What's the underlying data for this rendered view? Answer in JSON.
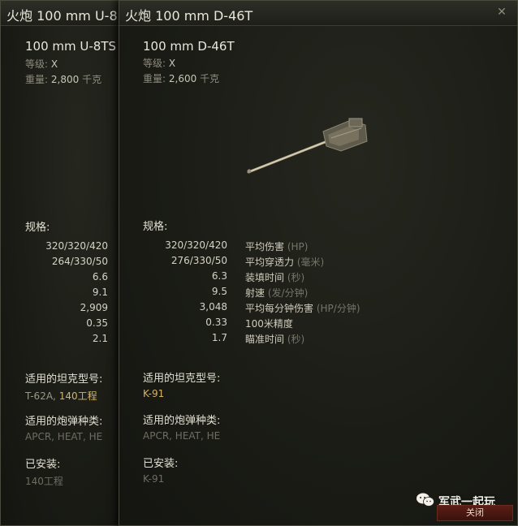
{
  "back_window": {
    "title": "火炮 100 mm U-8",
    "gun_name": "100 mm U-8TS",
    "tier_label": "等级:",
    "tier_value": "X",
    "weight_label": "重量:",
    "weight_value": "2,800",
    "weight_unit": "千克",
    "specs_heading": "规格:",
    "stats": [
      "320/320/420",
      "264/330/50",
      "6.6",
      "9.1",
      "2,909",
      "0.35",
      "2.1"
    ],
    "tanks_heading": "适用的坦克型号:",
    "tanks_plain": "T-62A,",
    "tanks_highlight": "140工程",
    "shells_heading": "适用的炮弹种类:",
    "shells": "APCR, HEAT, HE",
    "installed_heading": "已安装:",
    "installed": "140工程"
  },
  "front_window": {
    "title": "火炮 100 mm D-46T",
    "gun_name": "100 mm D-46T",
    "tier_label": "等级:",
    "tier_value": "X",
    "weight_label": "重量:",
    "weight_value": "2,600",
    "weight_unit": "千克",
    "specs_heading": "规格:",
    "stats": [
      {
        "value": "320/320/420",
        "name": "平均伤害",
        "unit": "(HP)"
      },
      {
        "value": "276/330/50",
        "name": "平均穿透力",
        "unit": "(毫米)"
      },
      {
        "value": "6.3",
        "name": "装填时间",
        "unit": "(秒)"
      },
      {
        "value": "9.5",
        "name": "射速",
        "unit": "(发/分钟)"
      },
      {
        "value": "3,048",
        "name": "平均每分钟伤害",
        "unit": "(HP/分钟)"
      },
      {
        "value": "0.33",
        "name": "100米精度",
        "unit": ""
      },
      {
        "value": "1.7",
        "name": "瞄准时间",
        "unit": "(秒)"
      }
    ],
    "tanks_heading": "适用的坦克型号:",
    "tanks": "K-91",
    "shells_heading": "适用的炮弹种类:",
    "shells": "APCR, HEAT, HE",
    "installed_heading": "已安装:",
    "installed": "K-91",
    "close_button": "关闭"
  },
  "watermark": "军武一起玩",
  "icons": {
    "close": "close-icon",
    "gun": "gun-icon",
    "watermark": "wechat-icon"
  },
  "colors": {
    "highlight": "#d4b46a",
    "close_button": "#5a1e16"
  }
}
